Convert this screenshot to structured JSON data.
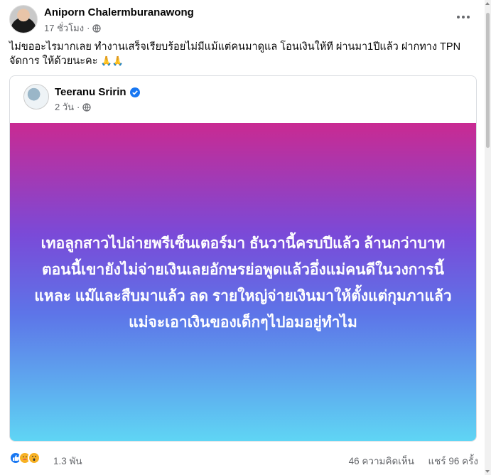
{
  "post": {
    "author": "Aniporn Chalermburanawong",
    "time": "17 ชั่วโมง",
    "separator": "·",
    "text": "ไม่ขออะไรมากเลย ทำงานเสร็จเรียบร้อยไม่มีแม้แต่คนมาดูแล โอนเงินให้ที ผ่านมา1ปีแล้ว ฝากทาง TPN จัดการ ให้ด้วยนะคะ",
    "text_emoji": "🙏🙏"
  },
  "shared": {
    "author": "Teeranu Sririn",
    "time": "2 วัน",
    "separator": "·",
    "body_text": "เทอลูกสาวไปถ่ายพรีเซ็นเตอร์มา ธันวานี้ครบปีแล้ว ล้านกว่าบาทตอนนี้เขายังไม่จ่ายเงินเลยอักษรย่อพูดแล้วอึ่งแม่คนดีในวงการนี้แหละ แม๊และสืบมาแล้ว ลด รายใหญ่จ่ายเงินมาให้ตั้งแต่กุมภาแล้วแม่จะเอาเงินของเด็กๆไปอมอยู่ทำไม",
    "gradient_colors": [
      "#c92a92",
      "#7a4ad8",
      "#5d75e8",
      "#5fd6f4"
    ]
  },
  "footer": {
    "reactions_count": "1.3 พัน",
    "comments": "46 ความคิดเห็น",
    "shares": "แชร์ 96 ครั้ง",
    "reaction_icons": [
      "like-icon",
      "care-icon",
      "wow-icon"
    ]
  },
  "colors": {
    "secondary_text": "#65676b",
    "verified": "#1877f2"
  }
}
